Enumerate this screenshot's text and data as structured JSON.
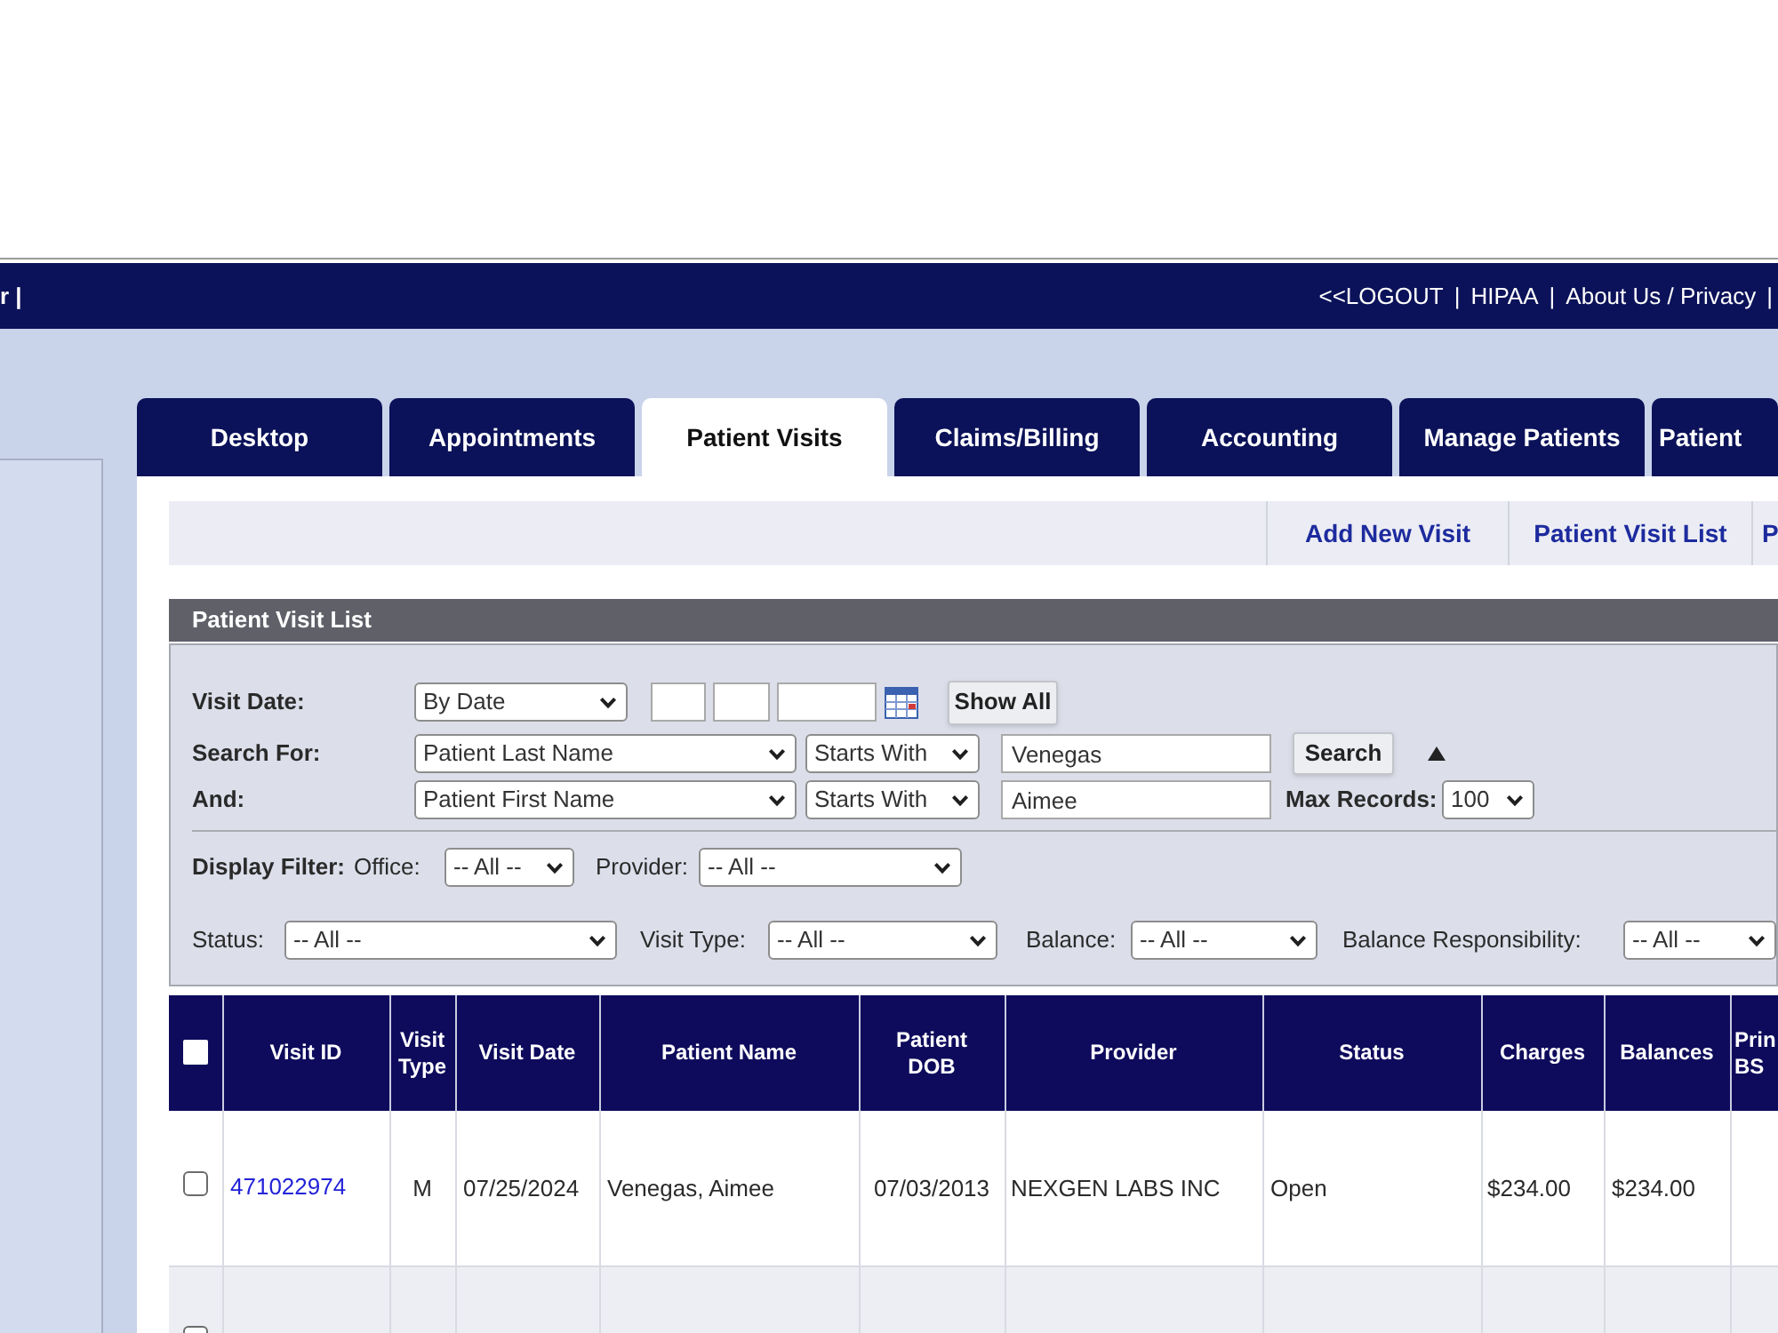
{
  "top_bar": {
    "left_text": "r |",
    "links": [
      {
        "label": "<<LOGOUT"
      },
      {
        "label": "HIPAA"
      },
      {
        "label": "About Us / Privacy"
      }
    ],
    "separator": "|"
  },
  "tabs": [
    {
      "label": "Desktop",
      "selected": false
    },
    {
      "label": "Appointments",
      "selected": false
    },
    {
      "label": "Patient Visits",
      "selected": true
    },
    {
      "label": "Claims/Billing",
      "selected": false
    },
    {
      "label": "Accounting",
      "selected": false
    },
    {
      "label": "Manage Patients",
      "selected": false
    },
    {
      "label": "Patient",
      "selected": false
    }
  ],
  "subnav": {
    "links": [
      "Add New Visit",
      "Patient Visit List",
      "P"
    ]
  },
  "panel": {
    "title": "Patient Visit List"
  },
  "filters": {
    "visit_date": {
      "label": "Visit Date:",
      "mode": "By Date",
      "button": "Show All"
    },
    "search_rows": [
      {
        "label": "Search For:",
        "field": "Patient Last Name",
        "operator": "Starts With",
        "value": "Venegas"
      },
      {
        "label": "And:",
        "field": "Patient First Name",
        "operator": "Starts With",
        "value": "Aimee"
      }
    ],
    "search_button": "Search",
    "max_records": {
      "label": "Max Records:",
      "value": "100"
    },
    "display_filter": {
      "label": "Display Filter:",
      "items": [
        {
          "label": "Office:",
          "value": "-- All --"
        },
        {
          "label": "Provider:",
          "value": "-- All --"
        }
      ]
    },
    "more_filters": [
      {
        "label": "Status:",
        "value": "-- All --"
      },
      {
        "label": "Visit Type:",
        "value": "-- All --"
      },
      {
        "label": "Balance:",
        "value": "-- All --"
      },
      {
        "label": "Balance Responsibility:",
        "value": "-- All --"
      }
    ]
  },
  "table": {
    "select_all": {
      "checked": false
    },
    "columns": [
      "Visit ID",
      "Visit Type",
      "Visit Date",
      "Patient Name",
      "Patient DOB",
      "Provider",
      "Status",
      "Charges",
      "Balances",
      "Prin BS"
    ],
    "rows": [
      {
        "checked": false,
        "cells": [
          "471022974",
          "M",
          "07/25/2024",
          "Venegas, Aimee",
          "07/03/2013",
          "NEXGEN LABS INC",
          "Open",
          "$234.00",
          "$234.00"
        ]
      },
      {
        "checked": false
      }
    ]
  }
}
